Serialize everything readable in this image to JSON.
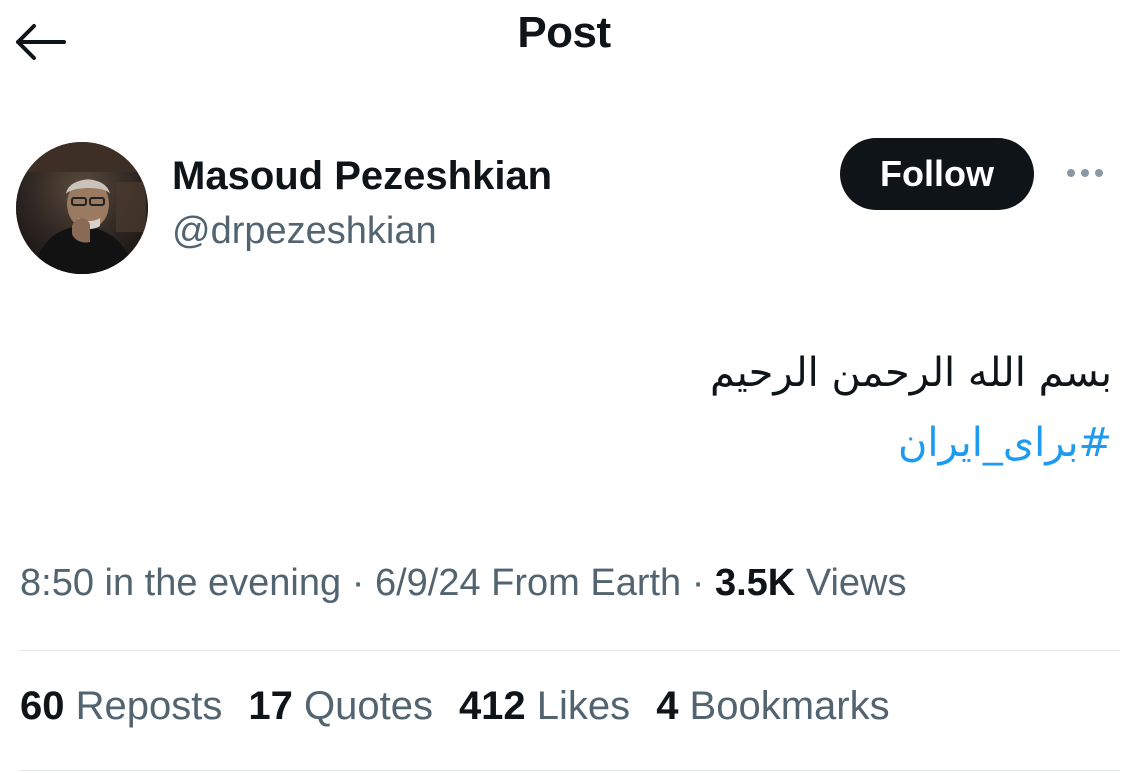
{
  "header": {
    "title": "Post",
    "back_icon": "arrow-left-icon"
  },
  "author": {
    "name": "Masoud Pezeshkian",
    "handle": "@drpezeshkian",
    "follow_label": "Follow",
    "more_icon": "more-horizontal-icon"
  },
  "post": {
    "text": "بسم الله الرحمن الرحیم",
    "hashtag": "#برای_ایران"
  },
  "meta": {
    "time": "8:50 in the evening",
    "separator1": " · ",
    "date": "6/9/24",
    "location": " From Earth",
    "separator2": " · ",
    "views_count": "3.5K",
    "views_label": " Views"
  },
  "stats": [
    {
      "count": "60",
      "label": " Reposts"
    },
    {
      "count": "17",
      "label": " Quotes"
    },
    {
      "count": "412",
      "label": " Likes"
    },
    {
      "count": "4",
      "label": " Bookmarks"
    }
  ],
  "colors": {
    "text": "#0f1419",
    "secondary": "#536471",
    "link": "#1d9bf0",
    "button_bg": "#0f1419",
    "divider": "#e1e6ea"
  }
}
